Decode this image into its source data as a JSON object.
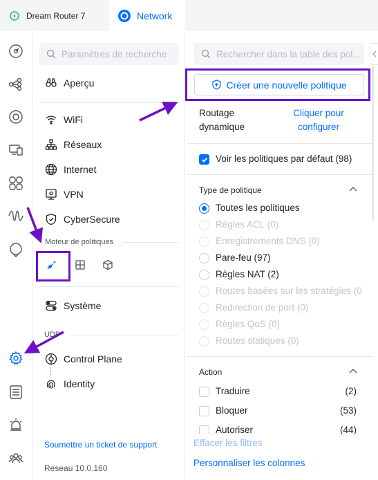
{
  "tabs": {
    "device": "Dream Router 7",
    "network": "Network"
  },
  "rail": {
    "icons": [
      "dashboard-icon",
      "topology-icon",
      "devices-icon",
      "clients-icon",
      "insights-icon",
      "traffic-icon",
      "alerts-icon",
      "settings-icon",
      "logs-icon",
      "notifications-icon",
      "admins-icon"
    ]
  },
  "settings_nav": {
    "search_placeholder": "Paramètres de recherche",
    "items": {
      "overview": "Aperçu",
      "wifi": "WiFi",
      "networks": "Réseaux",
      "internet": "Internet",
      "vpn": "VPN",
      "cybersecure": "CyberSecure",
      "system": "Système",
      "control_plane": "Control Plane",
      "identity": "Identity"
    },
    "policy_engine_label": "Moteur de politiques",
    "udp_label": "UDP",
    "support_link": "Soumettre un ticket de support",
    "version": "Réseau 10.0.160"
  },
  "policy_panel": {
    "search_placeholder": "Rechercher dans la table des pol...",
    "create_button": "Créer une nouvelle politique",
    "dynamic_routing_label_1": "Routage",
    "dynamic_routing_label_2": "dynamique",
    "dynamic_routing_link_1": "Cliquer pour",
    "dynamic_routing_link_2": "configurer",
    "show_default": "Voir les politiques par défaut (98)",
    "policy_type_heading": "Type de politique",
    "policy_types": [
      {
        "label": "Toutes les politiques",
        "state": "selected"
      },
      {
        "label": "Règles ACL (0)",
        "state": "disabled"
      },
      {
        "label": "Enregistrements DNS (0)",
        "state": "disabled"
      },
      {
        "label": "Pare-feu (97)",
        "state": "enabled"
      },
      {
        "label": "Règles NAT (2)",
        "state": "enabled"
      },
      {
        "label": "Routes basées sur les stratégies (0",
        "state": "disabled"
      },
      {
        "label": "Redirection de port (0)",
        "state": "disabled"
      },
      {
        "label": "Règles QoS (0)",
        "state": "disabled"
      },
      {
        "label": "Routes statiques (0)",
        "state": "disabled"
      }
    ],
    "action_heading": "Action",
    "actions": [
      {
        "label": "Traduire",
        "count": "(2)"
      },
      {
        "label": "Bloquer",
        "count": "(53)"
      },
      {
        "label": "Autoriser",
        "count": "(44)"
      }
    ],
    "clear_filters": "Effacer les filtres",
    "customize_columns": "Personnaliser les colonnes"
  },
  "colors": {
    "accent": "#006fff",
    "annotation": "#6b12c8"
  }
}
